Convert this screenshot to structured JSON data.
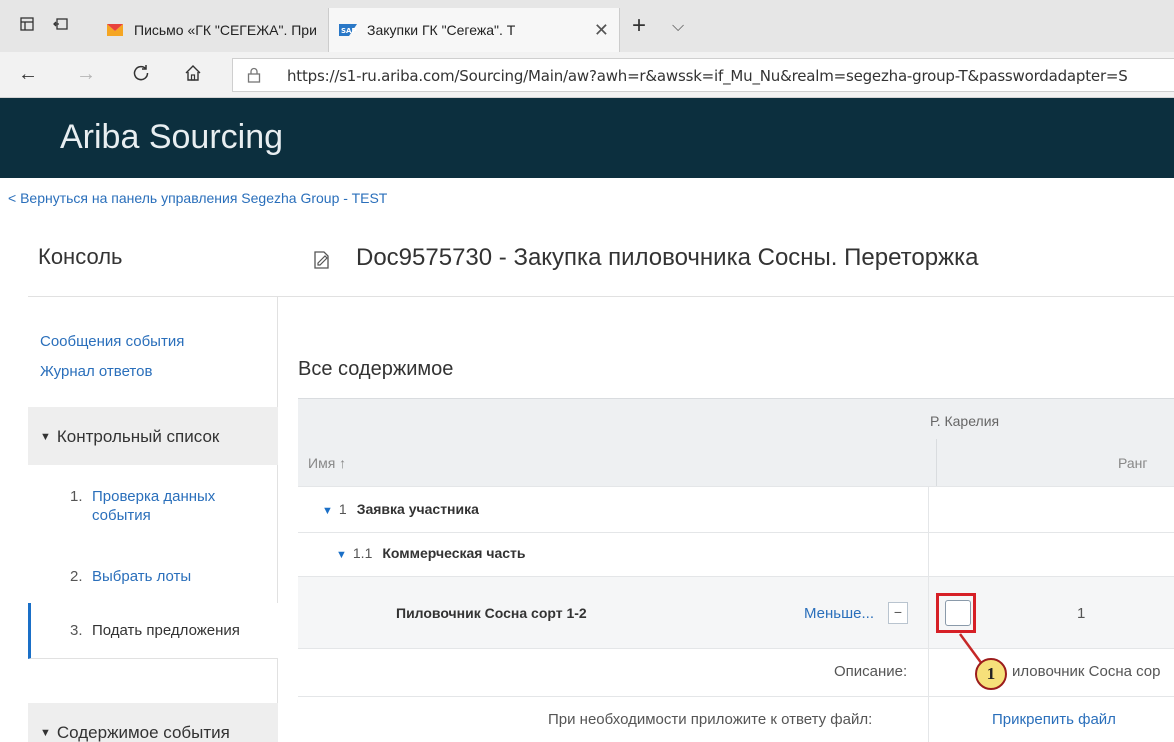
{
  "browser": {
    "tabs": [
      {
        "title": "Письмо «ГК \"СЕГЕЖА\". При",
        "active": false
      },
      {
        "title": "Закупки ГК \"Сегежа\". Т",
        "active": true
      }
    ],
    "url": "https://s1-ru.ariba.com/Sourcing/Main/aw?awh=r&awssk=if_Mu_Nu&realm=segezha-group-T&passwordadapter=S"
  },
  "header": {
    "brand": "Ariba Sourcing"
  },
  "back_link": "< Вернуться на панель управления Segezha Group - TEST",
  "sidebar": {
    "title": "Консоль",
    "links": [
      "Сообщения события",
      "Журнал ответов"
    ],
    "checklist_title": "Контрольный список",
    "steps": [
      {
        "num": "1.",
        "label": "Проверка данных события"
      },
      {
        "num": "2.",
        "label": "Выбрать лоты"
      },
      {
        "num": "3.",
        "label": "Подать предложения"
      }
    ],
    "content_title": "Содержимое события"
  },
  "main": {
    "doc_title": "Doc9575730 - Закупка пиловочника Сосны. Переторжка",
    "section_title": "Все содержимое",
    "grid": {
      "supplier": "Р. Карелия",
      "col_name": "Имя ↑",
      "col_rank": "Ранг",
      "rows": [
        {
          "num": "1",
          "label": "Заявка участника"
        },
        {
          "num": "1.1",
          "label": "Коммерческая часть"
        }
      ],
      "item": {
        "name": "Пиловочник Сосна сорт 1-2",
        "more": "Меньше...",
        "minus": "−",
        "rank": "1"
      },
      "desc_label": "Описание:",
      "desc_value": "иловочник Сосна сор",
      "attach_label": "При необходимости приложите к ответу файл:",
      "attach_link": "Прикрепить файл"
    },
    "callout": "1"
  },
  "colors": {
    "header_bg": "#0c2f3e",
    "link": "#2a6fbb",
    "highlight": "#d61f26",
    "callout_bg": "#f6e07a"
  }
}
